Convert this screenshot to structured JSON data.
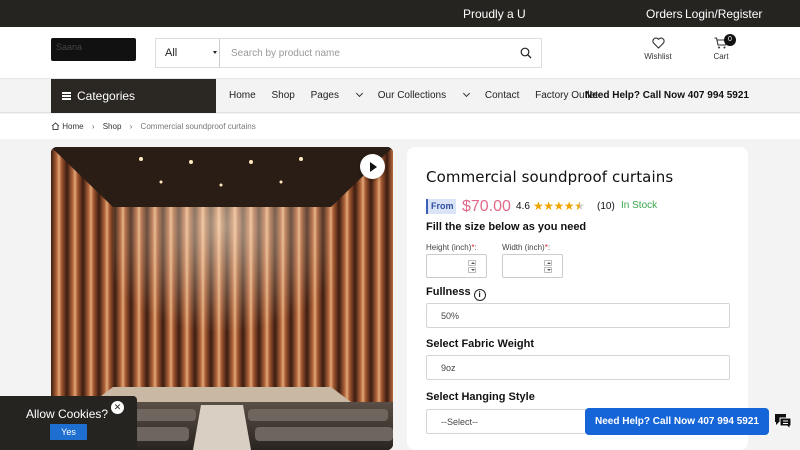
{
  "topbar": {
    "promo": "Proudly a U",
    "orders": "Orders",
    "login": "Login/Register"
  },
  "header": {
    "logo_text": "Saana",
    "search": {
      "category": "All",
      "placeholder": "Search by product name"
    },
    "wishlist_label": "Wishlist",
    "cart_label": "Cart",
    "cart_count": "0"
  },
  "nav": {
    "categories_label": "Categories",
    "links": [
      "Home",
      "Shop",
      "Pages",
      "Our Collections",
      "Contact",
      "Factory Outlet"
    ],
    "help": "Need Help? Call Now 407 994 5921"
  },
  "breadcrumb": {
    "home": "Home",
    "shop": "Shop",
    "current": "Commercial soundproof curtains"
  },
  "product": {
    "title": "Commercial soundproof curtains",
    "from_label": "From",
    "price": "$70.00",
    "rating": "4.6",
    "rating_value": 4.6,
    "review_count": "(10)",
    "stock": "In Stock",
    "fill_size_label": "Fill the size below as you need",
    "height_label": "Height (inch)",
    "width_label": "Width (inch)",
    "required_mark": "*",
    "colon": ":",
    "fullness_label": "Fullness",
    "fullness_value": "50%",
    "weight_label": "Select Fabric Weight",
    "weight_value": "9oz",
    "hanging_label": "Select Hanging Style",
    "hanging_value": "--Select--"
  },
  "cookie": {
    "question": "Allow Cookies?",
    "yes": "Yes"
  },
  "help_button": "Need Help? Call Now 407 994 5921",
  "colors": {
    "price": "#e06a8a",
    "stock": "#3aa54a",
    "primary_button": "#1565d8",
    "dark": "#262420"
  }
}
